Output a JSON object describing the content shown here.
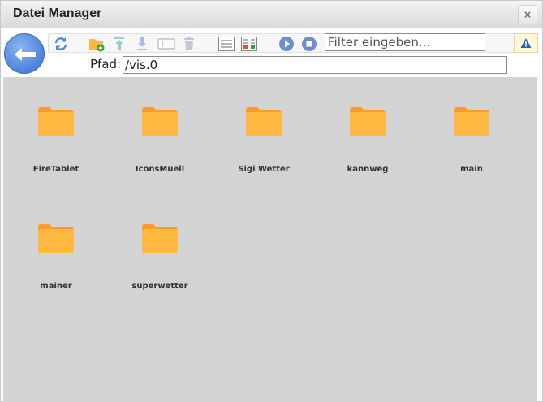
{
  "window": {
    "title": "Datei Manager",
    "close_label": "×"
  },
  "toolbar": {
    "filter_placeholder": "Filter eingeben...",
    "filter_value": ""
  },
  "path": {
    "label": "Pfad:",
    "value": "/vis.0"
  },
  "folders": [
    {
      "name": "FireTablet"
    },
    {
      "name": "IconsMuell"
    },
    {
      "name": "Sigi Wetter"
    },
    {
      "name": "kannweg"
    },
    {
      "name": "main"
    },
    {
      "name": "mainer"
    },
    {
      "name": "superwetter"
    }
  ],
  "colors": {
    "folder": "#fdb93f",
    "folder_tab": "#f89c2e",
    "background": "#d3d3d3",
    "accent": "#4f86dd"
  },
  "icons": {
    "back": "arrow-left-icon",
    "refresh": "refresh-icon",
    "new_folder": "folder-add-icon",
    "upload": "upload-icon",
    "download": "download-icon",
    "rename": "rename-icon",
    "delete": "trash-icon",
    "list_view": "list-view-icon",
    "detail_view": "detail-view-icon",
    "play": "play-icon",
    "stop": "stop-icon",
    "warning": "warning-icon"
  }
}
